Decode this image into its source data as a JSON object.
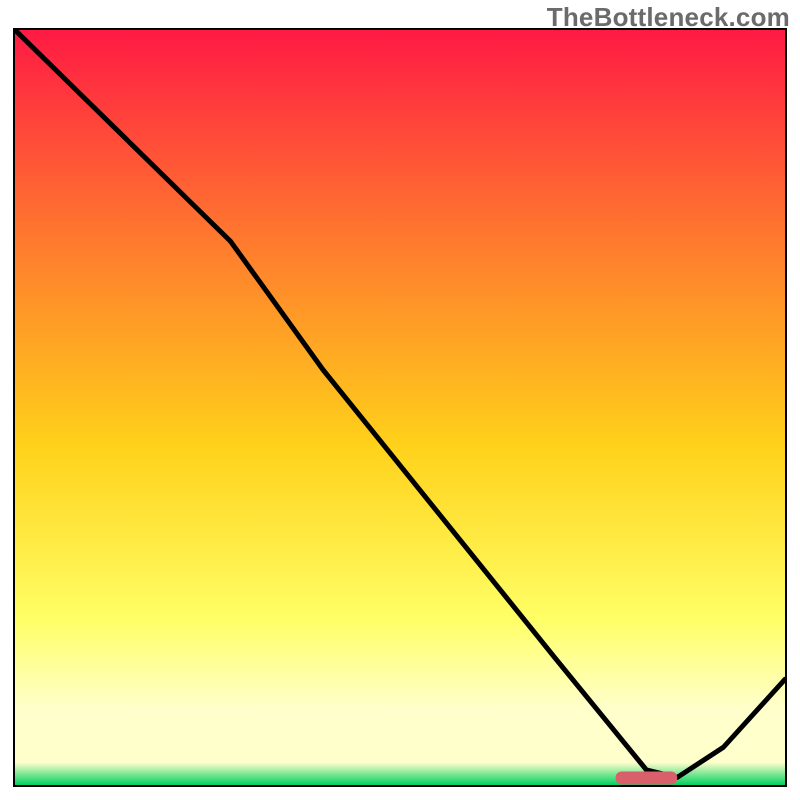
{
  "watermark": "TheBottleneck.com",
  "colors": {
    "gradient_top": "#ff1a44",
    "gradient_mid_upper": "#ff7a2e",
    "gradient_mid": "#ffd11a",
    "gradient_mid_lower": "#ffff66",
    "gradient_pale": "#ffffcc",
    "gradient_green": "#00d160",
    "curve": "#000000",
    "marker": "#d9606a"
  },
  "chart_data": {
    "type": "line",
    "title": "",
    "xlabel": "",
    "ylabel": "",
    "xlim": [
      0,
      100
    ],
    "ylim": [
      0,
      100
    ],
    "curve": {
      "x": [
        0,
        10,
        22,
        28,
        40,
        55,
        70,
        78,
        82,
        86,
        92,
        100
      ],
      "y": [
        100,
        90,
        78,
        72,
        55,
        36,
        17,
        7,
        2,
        1,
        5,
        14
      ]
    },
    "marker_segment": {
      "x_start": 78,
      "x_end": 86,
      "y": 1
    }
  }
}
